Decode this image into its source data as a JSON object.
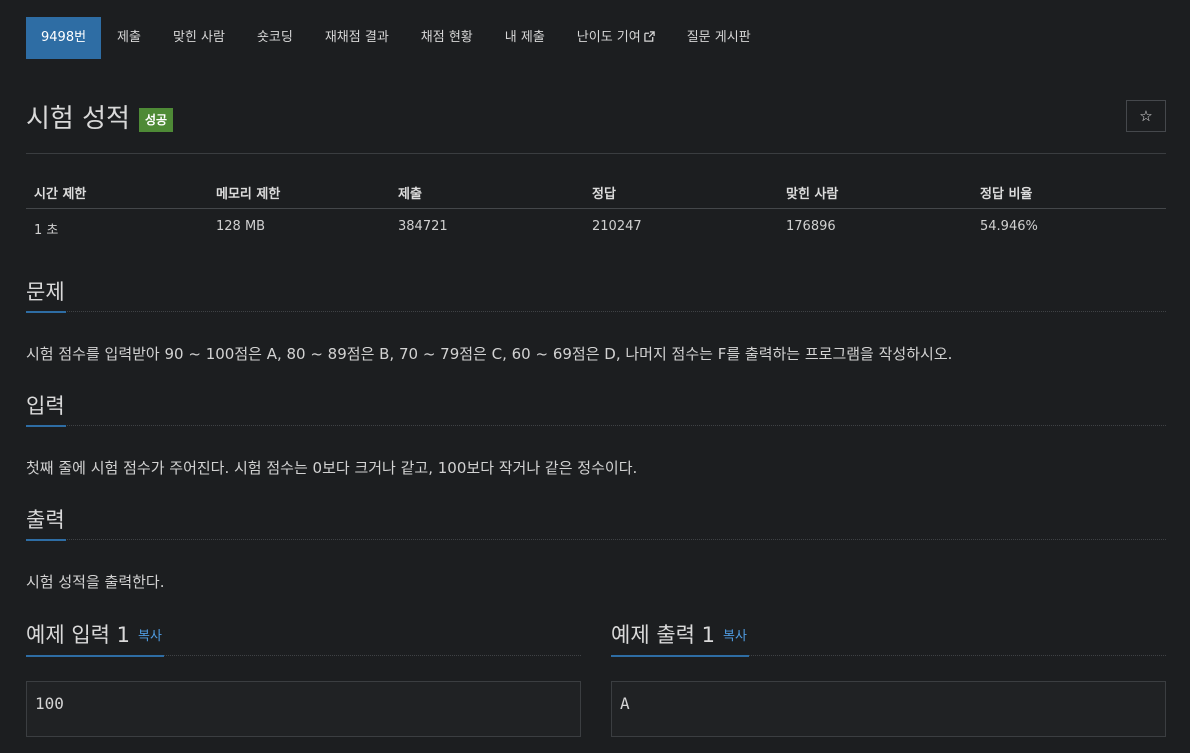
{
  "tabs": [
    {
      "label": "9498번",
      "active": true
    },
    {
      "label": "제출"
    },
    {
      "label": "맞힌 사람"
    },
    {
      "label": "숏코딩"
    },
    {
      "label": "재채점 결과"
    },
    {
      "label": "채점 현황"
    },
    {
      "label": "내 제출"
    },
    {
      "label": "난이도 기여",
      "icon": "external-link-icon"
    },
    {
      "label": "질문 게시판"
    }
  ],
  "problem": {
    "title": "시험 성적",
    "badge": "성공",
    "star_icon": "star-icon"
  },
  "info": {
    "headers": [
      "시간 제한",
      "메모리 제한",
      "제출",
      "정답",
      "맞힌 사람",
      "정답 비율"
    ],
    "values": [
      "1 초",
      "128 MB",
      "384721",
      "210247",
      "176896",
      "54.946%"
    ]
  },
  "sections": {
    "problem": {
      "heading": "문제",
      "text": "시험 점수를 입력받아 90 ~ 100점은 A, 80 ~ 89점은 B, 70 ~ 79점은 C, 60 ~ 69점은 D, 나머지 점수는 F를 출력하는 프로그램을 작성하시오."
    },
    "input": {
      "heading": "입력",
      "text": "첫째 줄에 시험 점수가 주어진다. 시험 점수는 0보다 크거나 같고, 100보다 작거나 같은 정수이다."
    },
    "output": {
      "heading": "출력",
      "text": "시험 성적을 출력한다."
    }
  },
  "samples": {
    "input": {
      "heading": "예제 입력 1",
      "copy_label": "복사",
      "value": "100"
    },
    "output": {
      "heading": "예제 출력 1",
      "copy_label": "복사",
      "value": "A"
    }
  },
  "colors": {
    "background": "#1c1e20",
    "accent": "#2e6da4",
    "success": "#4e8a36",
    "link": "#4f9be0"
  }
}
